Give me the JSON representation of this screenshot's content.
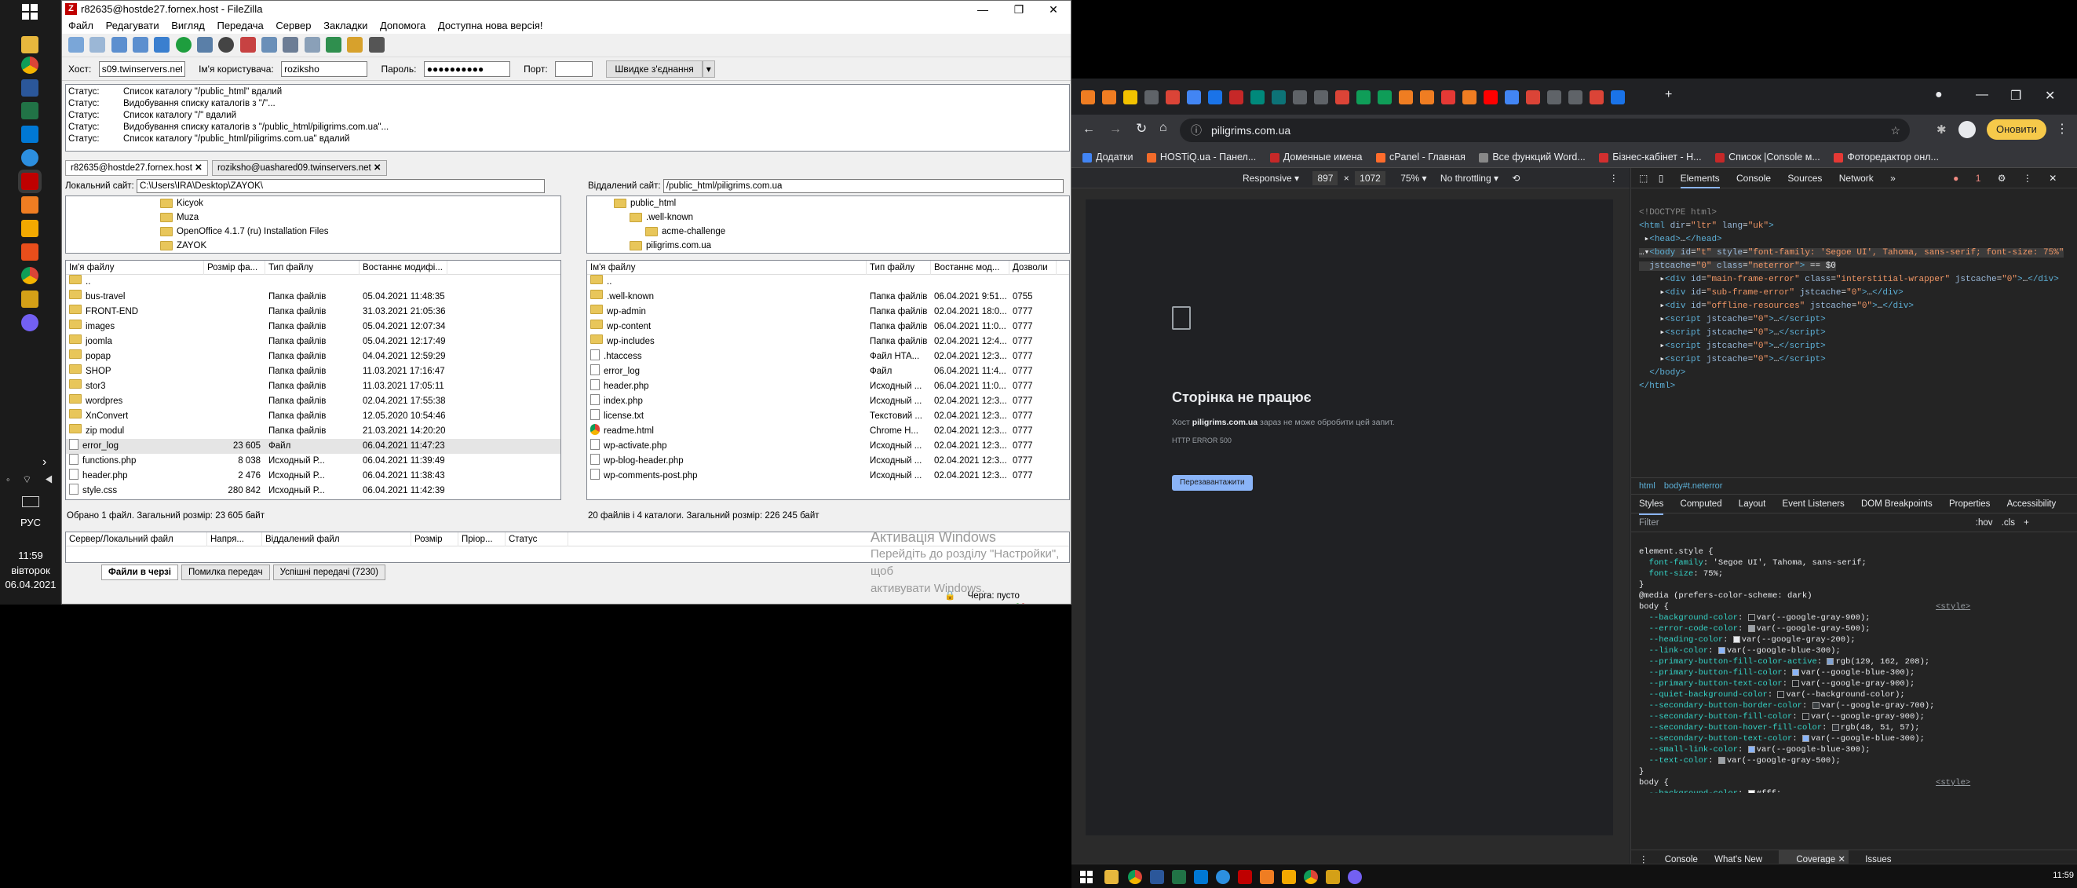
{
  "taskbar": {
    "lang": "РУС",
    "time": "11:59",
    "day": "вівторок",
    "date": "06.04.2021"
  },
  "filezilla": {
    "title": "r82635@hostde27.fornex.host - FileZilla",
    "menu": [
      "Файл",
      "Редагувати",
      "Вигляд",
      "Передача",
      "Сервер",
      "Закладки",
      "Допомога",
      "Доступна нова версія!"
    ],
    "quickconnect": {
      "host_label": "Хост:",
      "host_value": "s09.twinservers.net",
      "user_label": "Ім'я користувача:",
      "user_value": "roziksho",
      "pass_label": "Пароль:",
      "pass_value": "●●●●●●●●●●",
      "port_label": "Порт:",
      "port_value": "",
      "connect_label": "Швидке з'єднання"
    },
    "log": [
      {
        "k": "Статус:",
        "v": "Список каталогу \"/public_html\" вдалий"
      },
      {
        "k": "Статус:",
        "v": "Видобування списку каталогів з \"/\"..."
      },
      {
        "k": "Статус:",
        "v": "Список каталогу \"/\" вдалий"
      },
      {
        "k": "Статус:",
        "v": "Видобування списку каталогів з \"/public_html/piligrims.com.ua\"..."
      },
      {
        "k": "Статус:",
        "v": "Список каталогу \"/public_html/piligrims.com.ua\" вдалий"
      }
    ],
    "tabs": [
      "r82635@hostde27.fornex.host",
      "roziksho@uashared09.twinservers.net"
    ],
    "local": {
      "label": "Локальний сайт:",
      "path": "C:\\Users\\IRA\\Desktop\\ZAYOK\\",
      "tree": [
        "Kicyok",
        "Muza",
        "OpenOffice 4.1.7 (ru) Installation Files",
        "ZAYOK"
      ],
      "headers": [
        "Ім'я файлу",
        "Розмір фа...",
        "Тип файлу",
        "Востаннє модифі..."
      ],
      "rows": [
        {
          "name": "..",
          "size": "",
          "type": "",
          "date": "",
          "icon": "folder"
        },
        {
          "name": "bus-travel",
          "size": "",
          "type": "Папка файлів",
          "date": "05.04.2021 11:48:35",
          "icon": "folder"
        },
        {
          "name": "FRONT-END",
          "size": "",
          "type": "Папка файлів",
          "date": "31.03.2021 21:05:36",
          "icon": "folder"
        },
        {
          "name": "images",
          "size": "",
          "type": "Папка файлів",
          "date": "05.04.2021 12:07:34",
          "icon": "folder"
        },
        {
          "name": "joomla",
          "size": "",
          "type": "Папка файлів",
          "date": "05.04.2021 12:17:49",
          "icon": "folder"
        },
        {
          "name": "popap",
          "size": "",
          "type": "Папка файлів",
          "date": "04.04.2021 12:59:29",
          "icon": "folder"
        },
        {
          "name": "SHOP",
          "size": "",
          "type": "Папка файлів",
          "date": "11.03.2021 17:16:47",
          "icon": "folder"
        },
        {
          "name": "stor3",
          "size": "",
          "type": "Папка файлів",
          "date": "11.03.2021 17:05:11",
          "icon": "folder"
        },
        {
          "name": "wordpres",
          "size": "",
          "type": "Папка файлів",
          "date": "02.04.2021 17:55:38",
          "icon": "folder"
        },
        {
          "name": "XnConvert",
          "size": "",
          "type": "Папка файлів",
          "date": "12.05.2020 10:54:46",
          "icon": "folder"
        },
        {
          "name": "zip modul",
          "size": "",
          "type": "Папка файлів",
          "date": "21.03.2021 14:20:20",
          "icon": "folder"
        },
        {
          "name": "error_log",
          "size": "23 605",
          "type": "Файл",
          "date": "06.04.2021 11:47:23",
          "icon": "file"
        },
        {
          "name": "functions.php",
          "size": "8 038",
          "type": "Исходный Р...",
          "date": "06.04.2021 11:39:49",
          "icon": "file"
        },
        {
          "name": "header.php",
          "size": "2 476",
          "type": "Исходный Р...",
          "date": "06.04.2021 11:38:43",
          "icon": "file"
        },
        {
          "name": "style.css",
          "size": "280 842",
          "type": "Исходный Р...",
          "date": "06.04.2021 11:42:39",
          "icon": "file"
        }
      ],
      "status": "Обрано 1 файл. Загальний розмір: 23 605 байт"
    },
    "remote": {
      "label": "Віддалений сайт:",
      "path": "/public_html/piligrims.com.ua",
      "tree": [
        "public_html",
        ".well-known",
        "acme-challenge",
        "piligrims.com.ua"
      ],
      "headers": [
        "Ім'я файлу",
        "Тип файлу",
        "Востаннє мод...",
        "Дозволи"
      ],
      "rows": [
        {
          "name": "..",
          "type": "",
          "date": "",
          "perm": "",
          "icon": "folder"
        },
        {
          "name": ".well-known",
          "type": "Папка файлів",
          "date": "06.04.2021 9:51...",
          "perm": "0755",
          "icon": "folder"
        },
        {
          "name": "wp-admin",
          "type": "Папка файлів",
          "date": "02.04.2021 18:0...",
          "perm": "0777",
          "icon": "folder"
        },
        {
          "name": "wp-content",
          "type": "Папка файлів",
          "date": "06.04.2021 11:0...",
          "perm": "0777",
          "icon": "folder"
        },
        {
          "name": "wp-includes",
          "type": "Папка файлів",
          "date": "02.04.2021 12:4...",
          "perm": "0777",
          "icon": "folder"
        },
        {
          "name": ".htaccess",
          "type": "Файл HTA...",
          "date": "02.04.2021 12:3...",
          "perm": "0777",
          "icon": "file"
        },
        {
          "name": "error_log",
          "type": "Файл",
          "date": "06.04.2021 11:4...",
          "perm": "0777",
          "icon": "file"
        },
        {
          "name": "header.php",
          "type": "Исходный ...",
          "date": "06.04.2021 11:0...",
          "perm": "0777",
          "icon": "file"
        },
        {
          "name": "index.php",
          "type": "Исходный ...",
          "date": "02.04.2021 12:3...",
          "perm": "0777",
          "icon": "file"
        },
        {
          "name": "license.txt",
          "type": "Текстовий ...",
          "date": "02.04.2021 12:3...",
          "perm": "0777",
          "icon": "file"
        },
        {
          "name": "readme.html",
          "type": "Chrome H...",
          "date": "02.04.2021 12:3...",
          "perm": "0777",
          "icon": "chrome"
        },
        {
          "name": "wp-activate.php",
          "type": "Исходный ...",
          "date": "02.04.2021 12:3...",
          "perm": "0777",
          "icon": "file"
        },
        {
          "name": "wp-blog-header.php",
          "type": "Исходный ...",
          "date": "02.04.2021 12:3...",
          "perm": "0777",
          "icon": "file"
        },
        {
          "name": "wp-comments-post.php",
          "type": "Исходный ...",
          "date": "02.04.2021 12:3...",
          "perm": "0777",
          "icon": "file"
        }
      ],
      "status": "20 файлів і 4 каталоги. Загальний розмір: 226 245 байт"
    },
    "queue_headers": [
      "Сервер/Локальний файл",
      "Напря...",
      "Віддалений файл",
      "Розмір",
      "Пріор...",
      "Статус"
    ],
    "queue_tabs": [
      "Файли в черзі",
      "Помилка передач",
      "Успішні передачі (7230)"
    ],
    "queue_status": "Черга: пусто",
    "activation": {
      "line1": "Активація Windows",
      "line2": "Перейдіть до розділу \"Настройки\", щоб",
      "line3": "активувати Windows."
    }
  },
  "chrome": {
    "url": "piligrims.com.ua",
    "update_label": "Оновити",
    "bookmarks": [
      "Додатки",
      "HOSTiQ.ua - Панел...",
      "Доменные имена",
      "cPanel - Главная",
      "Все функций Word...",
      "Бізнес-кабінет - Н...",
      "Список |Console м...",
      "Фоторедактор онл..."
    ],
    "device": {
      "mode": "Responsive",
      "w": "897",
      "h": "1072",
      "zoom": "75%",
      "throttle": "No throttling"
    },
    "error_page": {
      "heading": "Сторінка не працює",
      "host": "piligrims.com.ua",
      "message_prefix": "Хост ",
      "message_suffix": " зараз не може обробити цей запит.",
      "code": "HTTP ERROR 500",
      "reload": "Перезавантажити"
    },
    "devtools": {
      "tabs": [
        "Elements",
        "Console",
        "Sources",
        "Network"
      ],
      "errors": "1",
      "breadcrumb": [
        "html",
        "body#t.neterror"
      ],
      "style_tabs": [
        "Styles",
        "Computed",
        "Layout",
        "Event Listeners",
        "DOM Breakpoints",
        "Properties",
        "Accessibility"
      ],
      "filter": "Filter",
      "hov": ":hov",
      "cls": ".cls",
      "drawer_tabs": [
        "Console",
        "What's New",
        "Coverage",
        "Issues"
      ],
      "media_query": "@media (prefers-color-scheme: dark)",
      "source": "<style>"
    }
  }
}
